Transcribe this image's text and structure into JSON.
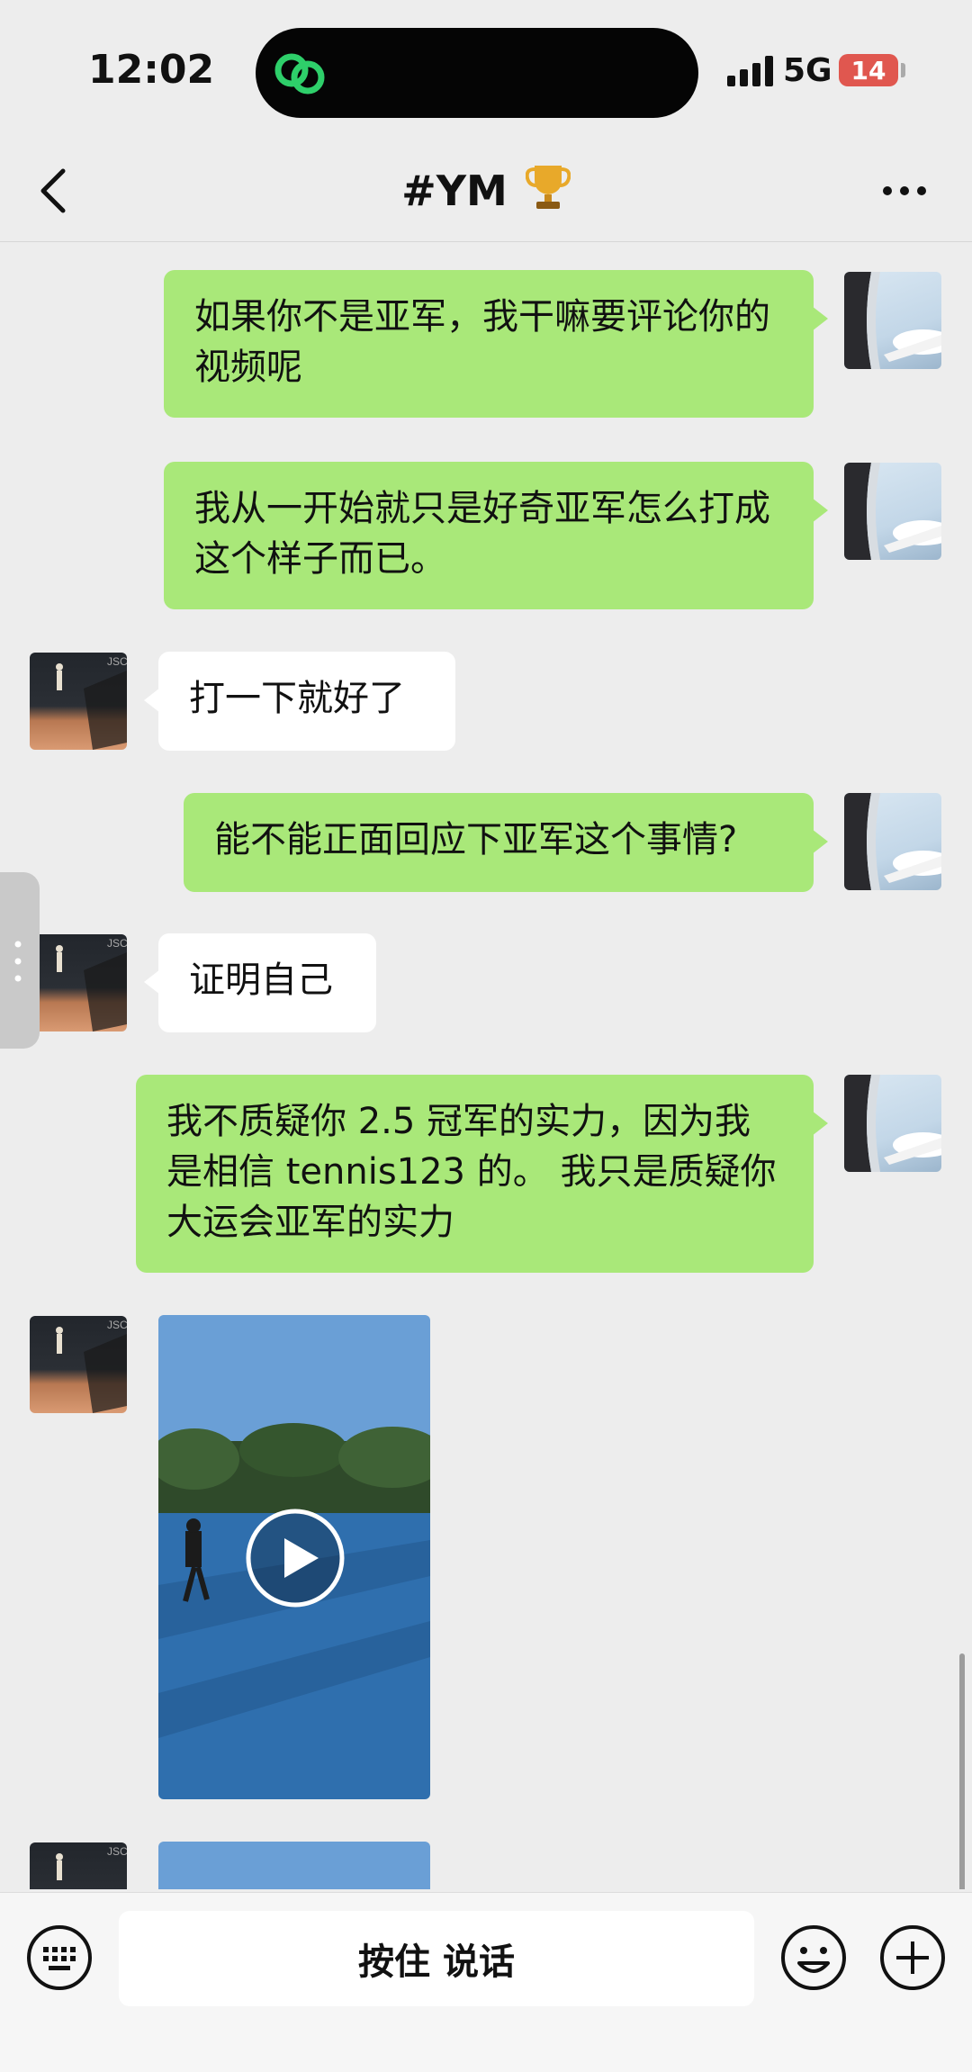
{
  "status_bar": {
    "time": "12:02",
    "network": "5G",
    "battery": "14"
  },
  "header": {
    "title": "#YM"
  },
  "messages": [
    {
      "sender": "me",
      "text": "如果你不是亚军，我干嘛要评论你的视频呢"
    },
    {
      "sender": "me",
      "text": "我从一开始就只是好奇亚军怎么打成这个样子而已。"
    },
    {
      "sender": "other",
      "text": "打一下就好了"
    },
    {
      "sender": "me",
      "text": "能不能正面回应下亚军这个事情?"
    },
    {
      "sender": "other",
      "text": "证明自己"
    },
    {
      "sender": "me",
      "text": "我不质疑你 2.5 冠军的实力，因为我是相信 tennis123 的。 我只是质疑你大运会亚军的实力"
    }
  ],
  "input_bar": {
    "voice_label": "按住 说话"
  },
  "colors": {
    "my_bubble": "#a9e879",
    "other_bubble": "#ffffff",
    "background": "#ededed"
  }
}
